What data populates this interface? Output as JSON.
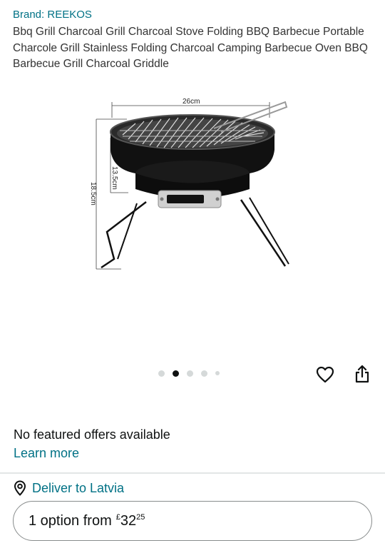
{
  "product": {
    "brand": "Brand: REEKOS",
    "title": "Bbq Grill Charcoal Grill Charcoal Stove Folding BBQ Barbecue Portable Charcole Grill Stainless Folding Charcoal Camping Barbecue Oven BBQ Barbecue Grill Charcoal Griddle",
    "image": {
      "dim_width": "26cm",
      "dim_height_outer": "18.5cm",
      "dim_height_inner": "13.5cm"
    }
  },
  "carousel": {
    "count": 5,
    "active_index": 1
  },
  "actions": {
    "favorite_icon": "heart-icon",
    "share_icon": "share-icon"
  },
  "offers": {
    "message": "No featured offers available",
    "learn_more": "Learn more"
  },
  "delivery": {
    "icon": "location-pin-icon",
    "text": "Deliver to Latvia"
  },
  "options_button": {
    "label": "1 option from",
    "currency": "£",
    "price_whole": "32",
    "price_fraction": "25"
  },
  "colors": {
    "link": "#007185",
    "text": "#0f1111",
    "divider": "#e3e6e6",
    "dot_inactive": "#d5d9d9"
  }
}
